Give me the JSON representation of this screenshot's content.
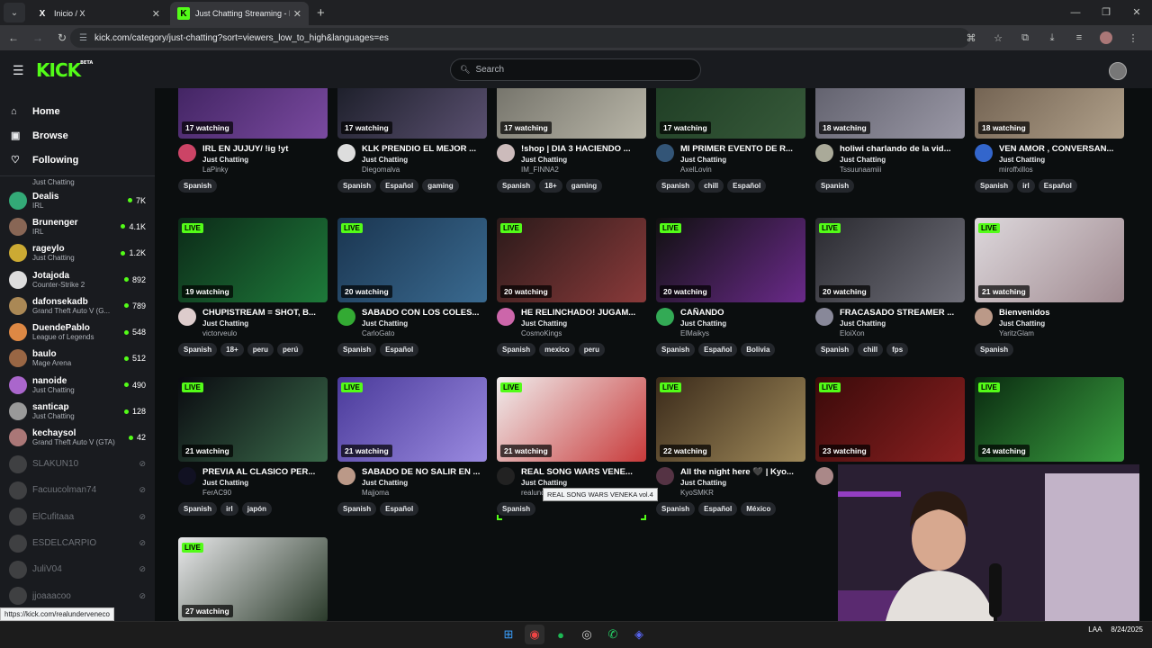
{
  "browser": {
    "tabs": [
      {
        "title": "Inicio / X",
        "favicon": "X"
      },
      {
        "title": "Just Chatting Streaming - Live S",
        "favicon": "K"
      }
    ],
    "url": "kick.com/category/just-chatting?sort=viewers_low_to_high&languages=es",
    "status_url": "https://kick.com/realunderveneco"
  },
  "header": {
    "logo": "KICK",
    "logo_beta": "BETA",
    "search_placeholder": "Search"
  },
  "sidebar": {
    "nav": [
      {
        "label": "Home",
        "icon": "home-icon"
      },
      {
        "label": "Browse",
        "icon": "browse-icon"
      },
      {
        "label": "Following",
        "icon": "heart-icon"
      }
    ],
    "partial_category": "Just Chatting",
    "channels": [
      {
        "name": "Dealis",
        "category": "IRL",
        "viewers": "7K",
        "color": "#3a7"
      },
      {
        "name": "Brunenger",
        "category": "IRL",
        "viewers": "4.1K",
        "color": "#865"
      },
      {
        "name": "rageylo",
        "category": "Just Chatting",
        "viewers": "1.2K",
        "color": "#ca3"
      },
      {
        "name": "Jotajoda",
        "category": "Counter-Strike 2",
        "viewers": "892",
        "color": "#ddd"
      },
      {
        "name": "dafonsekadb",
        "category": "Grand Theft Auto V (G...",
        "viewers": "789",
        "color": "#a85"
      },
      {
        "name": "DuendePablo",
        "category": "League of Legends",
        "viewers": "548",
        "color": "#d84"
      },
      {
        "name": "baulo",
        "category": "Mage Arena",
        "viewers": "512",
        "color": "#964"
      },
      {
        "name": "nanoide",
        "category": "Just Chatting",
        "viewers": "490",
        "color": "#a6c"
      },
      {
        "name": "santicap",
        "category": "Just Chatting",
        "viewers": "128",
        "color": "#999"
      },
      {
        "name": "kechaysol",
        "category": "Grand Theft Auto V (GTA)",
        "viewers": "42",
        "color": "#a77"
      }
    ],
    "offline": [
      {
        "name": "SLAKUN10",
        "color": "#777"
      },
      {
        "name": "Facuucolman74",
        "color": "#777"
      },
      {
        "name": "ElCufitaaa",
        "color": "#777"
      },
      {
        "name": "ESDELCARPIO",
        "color": "#777"
      },
      {
        "name": "JuliV04",
        "color": "#777"
      },
      {
        "name": "jjoaaacoo",
        "color": "#777"
      }
    ]
  },
  "streams": [
    {
      "watching": "17 watching",
      "live": "",
      "title": "IRL EN JUJUY/ !ig !yt",
      "category": "Just Chatting",
      "channel": "LaPinky",
      "tags": [
        "Spanish"
      ],
      "thumb": [
        "#3a1f5a",
        "#7a4aa0"
      ],
      "avatar": "#c46"
    },
    {
      "watching": "17 watching",
      "live": "",
      "title": "KLK PRENDIO EL MEJOR ...",
      "category": "Just Chatting",
      "channel": "Diegomalva",
      "tags": [
        "Spanish",
        "Español",
        "gaming"
      ],
      "thumb": [
        "#141820",
        "#5a5070"
      ],
      "avatar": "#ddd"
    },
    {
      "watching": "17 watching",
      "live": "",
      "title": "!shop | DIA 3 HACIENDO ...",
      "category": "Just Chatting",
      "channel": "IM_FINNA2",
      "tags": [
        "Spanish",
        "18+",
        "gaming"
      ],
      "thumb": [
        "#6b6a62",
        "#b9b6a8"
      ],
      "avatar": "#cbb"
    },
    {
      "watching": "17 watching",
      "live": "",
      "title": "MI PRIMER EVENTO DE R...",
      "category": "Just Chatting",
      "channel": "AxelLovin",
      "tags": [
        "Spanish",
        "chill",
        "Español"
      ],
      "thumb": [
        "#1c3a22",
        "#375a3a"
      ],
      "avatar": "#357"
    },
    {
      "watching": "18 watching",
      "live": "",
      "title": "holiwi charlando de la vid...",
      "category": "Just Chatting",
      "channel": "Tssuunaamiii",
      "tags": [
        "Spanish"
      ],
      "thumb": [
        "#5a5a66",
        "#9a98a6"
      ],
      "avatar": "#aa9"
    },
    {
      "watching": "18 watching",
      "live": "",
      "title": "VEN AMOR , CONVERSAN...",
      "category": "Just Chatting",
      "channel": "miroffxillos",
      "tags": [
        "Spanish",
        "irl",
        "Español"
      ],
      "thumb": [
        "#6a5a4a",
        "#b0a08a"
      ],
      "avatar": "#36c"
    },
    {
      "watching": "19 watching",
      "live": "LIVE",
      "title": "CHUPISTREAM = SHOT, B...",
      "category": "Just Chatting",
      "channel": "victorveulo",
      "tags": [
        "Spanish",
        "18+",
        "peru",
        "perú"
      ],
      "thumb": [
        "#0c2a18",
        "#1e7a3a"
      ],
      "avatar": "#dcc"
    },
    {
      "watching": "20 watching",
      "live": "LIVE",
      "title": "SABADO CON LOS COLES...",
      "category": "Just Chatting",
      "channel": "CarloGato",
      "tags": [
        "Spanish",
        "Español"
      ],
      "thumb": [
        "#1a3550",
        "#3a6a90"
      ],
      "avatar": "#3a3"
    },
    {
      "watching": "20 watching",
      "live": "LIVE",
      "title": "HE RELINCHADO! JUGAM...",
      "category": "Just Chatting",
      "channel": "CosmoKings",
      "tags": [
        "Spanish",
        "mexico",
        "peru"
      ],
      "thumb": [
        "#2a1a1a",
        "#8a3a3a"
      ],
      "avatar": "#c6a"
    },
    {
      "watching": "20 watching",
      "live": "LIVE",
      "title": "CAÑANDO",
      "category": "Just Chatting",
      "channel": "ElMaikys",
      "tags": [
        "Spanish",
        "Español",
        "Bolivia"
      ],
      "thumb": [
        "#101010",
        "#6a2a8a"
      ],
      "avatar": "#3a5"
    },
    {
      "watching": "20 watching",
      "live": "LIVE",
      "title": "FRACASADO STREAMER ...",
      "category": "Just Chatting",
      "channel": "EloiXon",
      "tags": [
        "Spanish",
        "chill",
        "fps"
      ],
      "thumb": [
        "#2a2a30",
        "#70707a"
      ],
      "avatar": "#889"
    },
    {
      "watching": "21 watching",
      "live": "LIVE",
      "title": "Bienvenidos",
      "category": "Just Chatting",
      "channel": "YaritzGlam",
      "tags": [
        "Spanish"
      ],
      "thumb": [
        "#ddd8dc",
        "#a08a90"
      ],
      "avatar": "#b98"
    },
    {
      "watching": "21 watching",
      "live": "LIVE",
      "title": "PREVIA AL CLASICO PER...",
      "category": "Just Chatting",
      "channel": "FerAC90",
      "tags": [
        "Spanish",
        "irl",
        "japón"
      ],
      "thumb": [
        "#0a0a10",
        "#3a6a4a"
      ],
      "avatar": "#112"
    },
    {
      "watching": "21 watching",
      "live": "LIVE",
      "title": "SABADO DE NO SALIR EN ...",
      "category": "Just Chatting",
      "channel": "Majjoma",
      "tags": [
        "Spanish",
        "Español"
      ],
      "thumb": [
        "#4a3a9a",
        "#9a8ae0"
      ],
      "avatar": "#b98"
    },
    {
      "watching": "21 watching",
      "live": "LIVE",
      "title": "REAL SONG WARS VENE...",
      "category": "Just Chatting",
      "channel": "realunderveneco",
      "tags": [
        "Spanish"
      ],
      "thumb": [
        "#f0eeee",
        "#c83a3a"
      ],
      "avatar": "#222"
    },
    {
      "watching": "22 watching",
      "live": "LIVE",
      "title": "All the night here 🖤 | Kyo...",
      "category": "Just Chatting",
      "channel": "KyoSMKR",
      "tags": [
        "Spanish",
        "Español",
        "México"
      ],
      "thumb": [
        "#3a2a1a",
        "#a08a5a"
      ],
      "avatar": "#534"
    },
    {
      "watching": "23 watching",
      "live": "LIVE",
      "title": "",
      "category": "",
      "channel": "",
      "tags": [],
      "thumb": [
        "#3a0a0a",
        "#8a2020"
      ],
      "avatar": "#a88"
    },
    {
      "watching": "24 watching",
      "live": "LIVE",
      "title": "",
      "category": "",
      "channel": "",
      "tags": [],
      "thumb": [
        "#0a2a10",
        "#3aa040"
      ],
      "avatar": "#777"
    },
    {
      "watching": "27 watching",
      "live": "LIVE",
      "title": "",
      "category": "",
      "channel": "",
      "tags": [],
      "thumb": [
        "#e8e8ea",
        "#2a3a2a"
      ],
      "avatar": "#777"
    }
  ],
  "tooltip": "REAL SONG WARS VENEKA vol.4",
  "taskbar": {
    "lang": "LAA",
    "date": "8/24/2025"
  }
}
